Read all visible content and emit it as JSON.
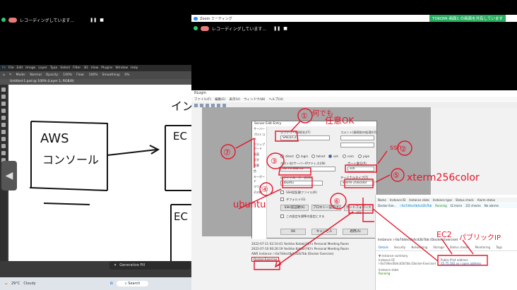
{
  "left_recording": {
    "text": "レコーディングしています...",
    "pause": "❚❚",
    "stop": "■"
  },
  "right_recording": {
    "text": "レコーディングしています...",
    "pause": "❚❚",
    "stop": "■"
  },
  "right_window": {
    "title": "Zoom ミーティング",
    "share_banner": "TOKOMI 画面1 の画面を共有しています"
  },
  "photoshop": {
    "menu": [
      "File",
      "Edit",
      "Image",
      "Layer",
      "Type",
      "Select",
      "Filter",
      "3D",
      "View",
      "Plugins",
      "Window",
      "Help"
    ],
    "options": [
      "Mode:",
      "Normal",
      "Opacity:",
      "100%",
      "Flow:",
      "100%",
      "Smoothing:",
      "0%"
    ],
    "tab": "Untitled-1.psd @ 100% (Layer 1, RGB/8)",
    "sketch_aws": "AWS",
    "sketch_console": "コンソール",
    "sketch_right_top": "インス",
    "sketch_ec": "EC",
    "float_bar": "Generative Fill",
    "taskbar_temp": "29°C",
    "taskbar_weather": "Cloudy",
    "taskbar_search": "Search",
    "handle_icon": "◀"
  },
  "rlogin": {
    "title": "RLogin",
    "menu": [
      "ファイル(F)",
      "編集(E)",
      "表示(V)",
      "ウィンドウ(W)",
      "ヘルプ(H)"
    ]
  },
  "dialog": {
    "title": "Server Edit Entry",
    "sidebar": [
      "サーバー",
      "プロトコル",
      "クリップボード",
      "画面",
      "文字",
      "背景",
      "色",
      "キーボード",
      "マウス",
      "その他"
    ],
    "entry_label": "エントリー(接続名)(T)",
    "entry_value": "SAE(EC2)",
    "comment_label": "コメント(接続前の処理)(O)",
    "host_label": "ホスト名(サーバーIPアドレス)(N)",
    "host_value": "35.75.182.xx",
    "port_label": "ポート番号(P)",
    "port_value": "ssh",
    "login_label": "ログインユーザー名(U)",
    "login_value": "ubuntu",
    "terminal_label": "ターミナルタイプ(T)",
    "terminal_value": "xterm-256color",
    "default_label": "デフォルト(G)",
    "radio_labels": [
      "direct",
      "login",
      "telnet",
      "ssh",
      "com",
      "pipe"
    ],
    "key_check": "SSH認証鍵ファイル(K)",
    "key_button": "SSH認証鍵(K)",
    "proxy_button": "プロキシー設定(X)",
    "forward_button": "ポートフォワード(O)",
    "group_check": "この設定を標準の設定にする",
    "ok_button": "OK",
    "cancel_button": "キャンセル",
    "apply_button": "適用(A)"
  },
  "log": [
    "2022-07-11 02:10:41 Yoshiko Kotaki(YK)'s Personal Meeting Room",
    "2022-07-10 06:26:19 Yoshiko Kotaki(YK)'s Personal Meeting Room",
    "AWS Instance: i-0a7d4ec0b4cd2b7bb (Docker Exercise)",
    "Docker-Exercise"
  ],
  "aws": {
    "columns": [
      "Name",
      "Instance ID",
      "Instance state",
      "Instance type",
      "Status check",
      "Alarm status"
    ],
    "row": [
      "Docker Exe...",
      "i-0a7d4ec0b4cd2b7bb",
      "Running",
      "t2.micro",
      "2/2 checks",
      "No alarms"
    ],
    "instance_title": "Instance: i-0a7d4ec0b4cd2b7bb (Docker Exercise)",
    "tabs": [
      "Details",
      "Security",
      "Networking",
      "Storage",
      "Status checks",
      "Monitoring",
      "Tags"
    ],
    "summary_label": "▼ Instance summary",
    "instance_id_label": "Instance ID",
    "instance_id_value": "i-0a7d4ec0b4cd2b7bb (Docker-Exercise)",
    "public_ip_label": "Public IPv4 address",
    "public_ip_value": "35.75.182.xx | open address",
    "instance_state_label": "Instance state",
    "instance_state_value": "Running"
  },
  "annotations": {
    "note1_a": "①",
    "note1_b": "何でも",
    "note1_c": "任意OK",
    "note2": "ssh",
    "note2_num": "②",
    "note3": "③",
    "note4": "④",
    "note5_num": "⑤",
    "note5_text": "xterm256color",
    "note6": "⑥",
    "note7": "⑦",
    "ubuntu": "ubuntu",
    "ec2": "EC2",
    "public_ip": "パブリックIP"
  }
}
